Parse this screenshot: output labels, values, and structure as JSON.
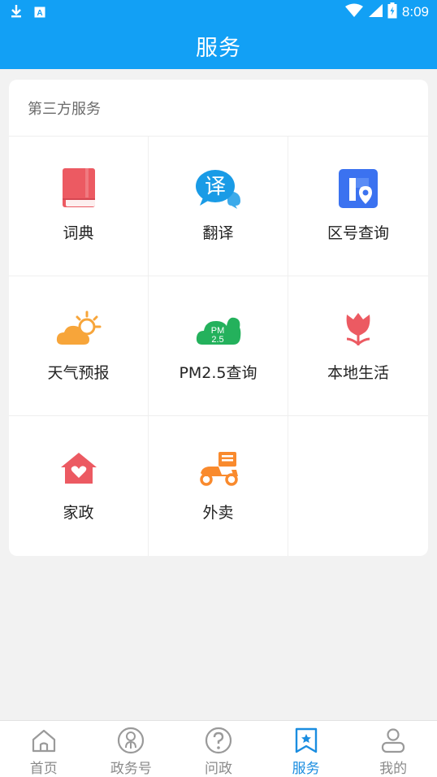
{
  "status_bar": {
    "time": "8:09",
    "icons": [
      "download-icon",
      "a-box-icon",
      "wifi-icon",
      "signal-icon",
      "battery-icon"
    ]
  },
  "app_bar": {
    "title": "服务"
  },
  "card": {
    "header": "第三方服务",
    "items": [
      {
        "label": "词典",
        "icon": "book-icon",
        "color": "#ec5a62"
      },
      {
        "label": "翻译",
        "icon": "translate-icon",
        "color": "#1a9be6"
      },
      {
        "label": "区号查询",
        "icon": "location-pin-icon",
        "color": "#3b72f0"
      },
      {
        "label": "天气预报",
        "icon": "sun-cloud-icon",
        "color": "#f7a53a"
      },
      {
        "label": "PM2.5查询",
        "icon": "pm25-cloud-icon",
        "color": "#24b15c"
      },
      {
        "label": "本地生活",
        "icon": "tulip-icon",
        "color": "#ec5a62"
      },
      {
        "label": "家政",
        "icon": "house-heart-icon",
        "color": "#ec5a62"
      },
      {
        "label": "外卖",
        "icon": "scooter-icon",
        "color": "#f98a2d"
      }
    ]
  },
  "bottom_nav": {
    "items": [
      {
        "label": "首页",
        "icon": "home-icon",
        "active": false
      },
      {
        "label": "政务号",
        "icon": "user-circle-icon",
        "active": false
      },
      {
        "label": "问政",
        "icon": "question-icon",
        "active": false
      },
      {
        "label": "服务",
        "icon": "bookmark-star-icon",
        "active": true
      },
      {
        "label": "我的",
        "icon": "profile-icon",
        "active": false
      }
    ]
  },
  "colors": {
    "primary": "#12a0f5",
    "active_tab": "#1a8de0",
    "background": "#f2f2f2"
  }
}
